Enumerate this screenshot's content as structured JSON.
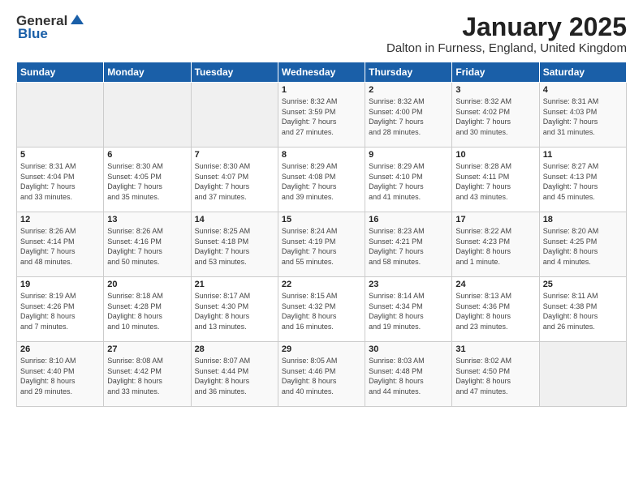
{
  "logo": {
    "general": "General",
    "blue": "Blue"
  },
  "title": "January 2025",
  "subtitle": "Dalton in Furness, England, United Kingdom",
  "headers": [
    "Sunday",
    "Monday",
    "Tuesday",
    "Wednesday",
    "Thursday",
    "Friday",
    "Saturday"
  ],
  "weeks": [
    [
      {
        "day": "",
        "info": ""
      },
      {
        "day": "",
        "info": ""
      },
      {
        "day": "",
        "info": ""
      },
      {
        "day": "1",
        "info": "Sunrise: 8:32 AM\nSunset: 3:59 PM\nDaylight: 7 hours\nand 27 minutes."
      },
      {
        "day": "2",
        "info": "Sunrise: 8:32 AM\nSunset: 4:00 PM\nDaylight: 7 hours\nand 28 minutes."
      },
      {
        "day": "3",
        "info": "Sunrise: 8:32 AM\nSunset: 4:02 PM\nDaylight: 7 hours\nand 30 minutes."
      },
      {
        "day": "4",
        "info": "Sunrise: 8:31 AM\nSunset: 4:03 PM\nDaylight: 7 hours\nand 31 minutes."
      }
    ],
    [
      {
        "day": "5",
        "info": "Sunrise: 8:31 AM\nSunset: 4:04 PM\nDaylight: 7 hours\nand 33 minutes."
      },
      {
        "day": "6",
        "info": "Sunrise: 8:30 AM\nSunset: 4:05 PM\nDaylight: 7 hours\nand 35 minutes."
      },
      {
        "day": "7",
        "info": "Sunrise: 8:30 AM\nSunset: 4:07 PM\nDaylight: 7 hours\nand 37 minutes."
      },
      {
        "day": "8",
        "info": "Sunrise: 8:29 AM\nSunset: 4:08 PM\nDaylight: 7 hours\nand 39 minutes."
      },
      {
        "day": "9",
        "info": "Sunrise: 8:29 AM\nSunset: 4:10 PM\nDaylight: 7 hours\nand 41 minutes."
      },
      {
        "day": "10",
        "info": "Sunrise: 8:28 AM\nSunset: 4:11 PM\nDaylight: 7 hours\nand 43 minutes."
      },
      {
        "day": "11",
        "info": "Sunrise: 8:27 AM\nSunset: 4:13 PM\nDaylight: 7 hours\nand 45 minutes."
      }
    ],
    [
      {
        "day": "12",
        "info": "Sunrise: 8:26 AM\nSunset: 4:14 PM\nDaylight: 7 hours\nand 48 minutes."
      },
      {
        "day": "13",
        "info": "Sunrise: 8:26 AM\nSunset: 4:16 PM\nDaylight: 7 hours\nand 50 minutes."
      },
      {
        "day": "14",
        "info": "Sunrise: 8:25 AM\nSunset: 4:18 PM\nDaylight: 7 hours\nand 53 minutes."
      },
      {
        "day": "15",
        "info": "Sunrise: 8:24 AM\nSunset: 4:19 PM\nDaylight: 7 hours\nand 55 minutes."
      },
      {
        "day": "16",
        "info": "Sunrise: 8:23 AM\nSunset: 4:21 PM\nDaylight: 7 hours\nand 58 minutes."
      },
      {
        "day": "17",
        "info": "Sunrise: 8:22 AM\nSunset: 4:23 PM\nDaylight: 8 hours\nand 1 minute."
      },
      {
        "day": "18",
        "info": "Sunrise: 8:20 AM\nSunset: 4:25 PM\nDaylight: 8 hours\nand 4 minutes."
      }
    ],
    [
      {
        "day": "19",
        "info": "Sunrise: 8:19 AM\nSunset: 4:26 PM\nDaylight: 8 hours\nand 7 minutes."
      },
      {
        "day": "20",
        "info": "Sunrise: 8:18 AM\nSunset: 4:28 PM\nDaylight: 8 hours\nand 10 minutes."
      },
      {
        "day": "21",
        "info": "Sunrise: 8:17 AM\nSunset: 4:30 PM\nDaylight: 8 hours\nand 13 minutes."
      },
      {
        "day": "22",
        "info": "Sunrise: 8:15 AM\nSunset: 4:32 PM\nDaylight: 8 hours\nand 16 minutes."
      },
      {
        "day": "23",
        "info": "Sunrise: 8:14 AM\nSunset: 4:34 PM\nDaylight: 8 hours\nand 19 minutes."
      },
      {
        "day": "24",
        "info": "Sunrise: 8:13 AM\nSunset: 4:36 PM\nDaylight: 8 hours\nand 23 minutes."
      },
      {
        "day": "25",
        "info": "Sunrise: 8:11 AM\nSunset: 4:38 PM\nDaylight: 8 hours\nand 26 minutes."
      }
    ],
    [
      {
        "day": "26",
        "info": "Sunrise: 8:10 AM\nSunset: 4:40 PM\nDaylight: 8 hours\nand 29 minutes."
      },
      {
        "day": "27",
        "info": "Sunrise: 8:08 AM\nSunset: 4:42 PM\nDaylight: 8 hours\nand 33 minutes."
      },
      {
        "day": "28",
        "info": "Sunrise: 8:07 AM\nSunset: 4:44 PM\nDaylight: 8 hours\nand 36 minutes."
      },
      {
        "day": "29",
        "info": "Sunrise: 8:05 AM\nSunset: 4:46 PM\nDaylight: 8 hours\nand 40 minutes."
      },
      {
        "day": "30",
        "info": "Sunrise: 8:03 AM\nSunset: 4:48 PM\nDaylight: 8 hours\nand 44 minutes."
      },
      {
        "day": "31",
        "info": "Sunrise: 8:02 AM\nSunset: 4:50 PM\nDaylight: 8 hours\nand 47 minutes."
      },
      {
        "day": "",
        "info": ""
      }
    ]
  ]
}
